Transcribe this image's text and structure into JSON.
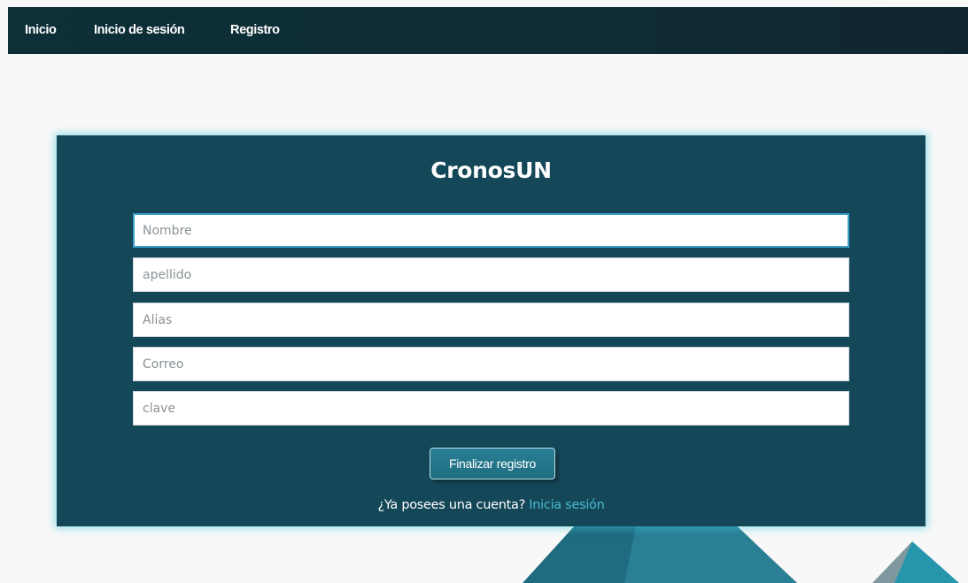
{
  "nav": {
    "items": [
      {
        "label": "Inicio"
      },
      {
        "label": "Inicio de sesión"
      },
      {
        "label": "Registro"
      }
    ]
  },
  "form": {
    "title": "CronosUN",
    "fields": [
      {
        "placeholder": "Nombre",
        "value": ""
      },
      {
        "placeholder": "apellido",
        "value": ""
      },
      {
        "placeholder": "Alias",
        "value": ""
      },
      {
        "placeholder": "Correo",
        "value": ""
      },
      {
        "placeholder": "clave",
        "value": ""
      }
    ],
    "submit_label": "Finalizar registro",
    "account_prompt": "¿Ya posees una cuenta?",
    "login_link": "Inicia sesión"
  },
  "colors": {
    "nav_background": "#0e2f37",
    "card_background": "#144758",
    "card_glow": "#3cc8dc",
    "link": "#49b9d0",
    "button": "#2a7e93"
  }
}
